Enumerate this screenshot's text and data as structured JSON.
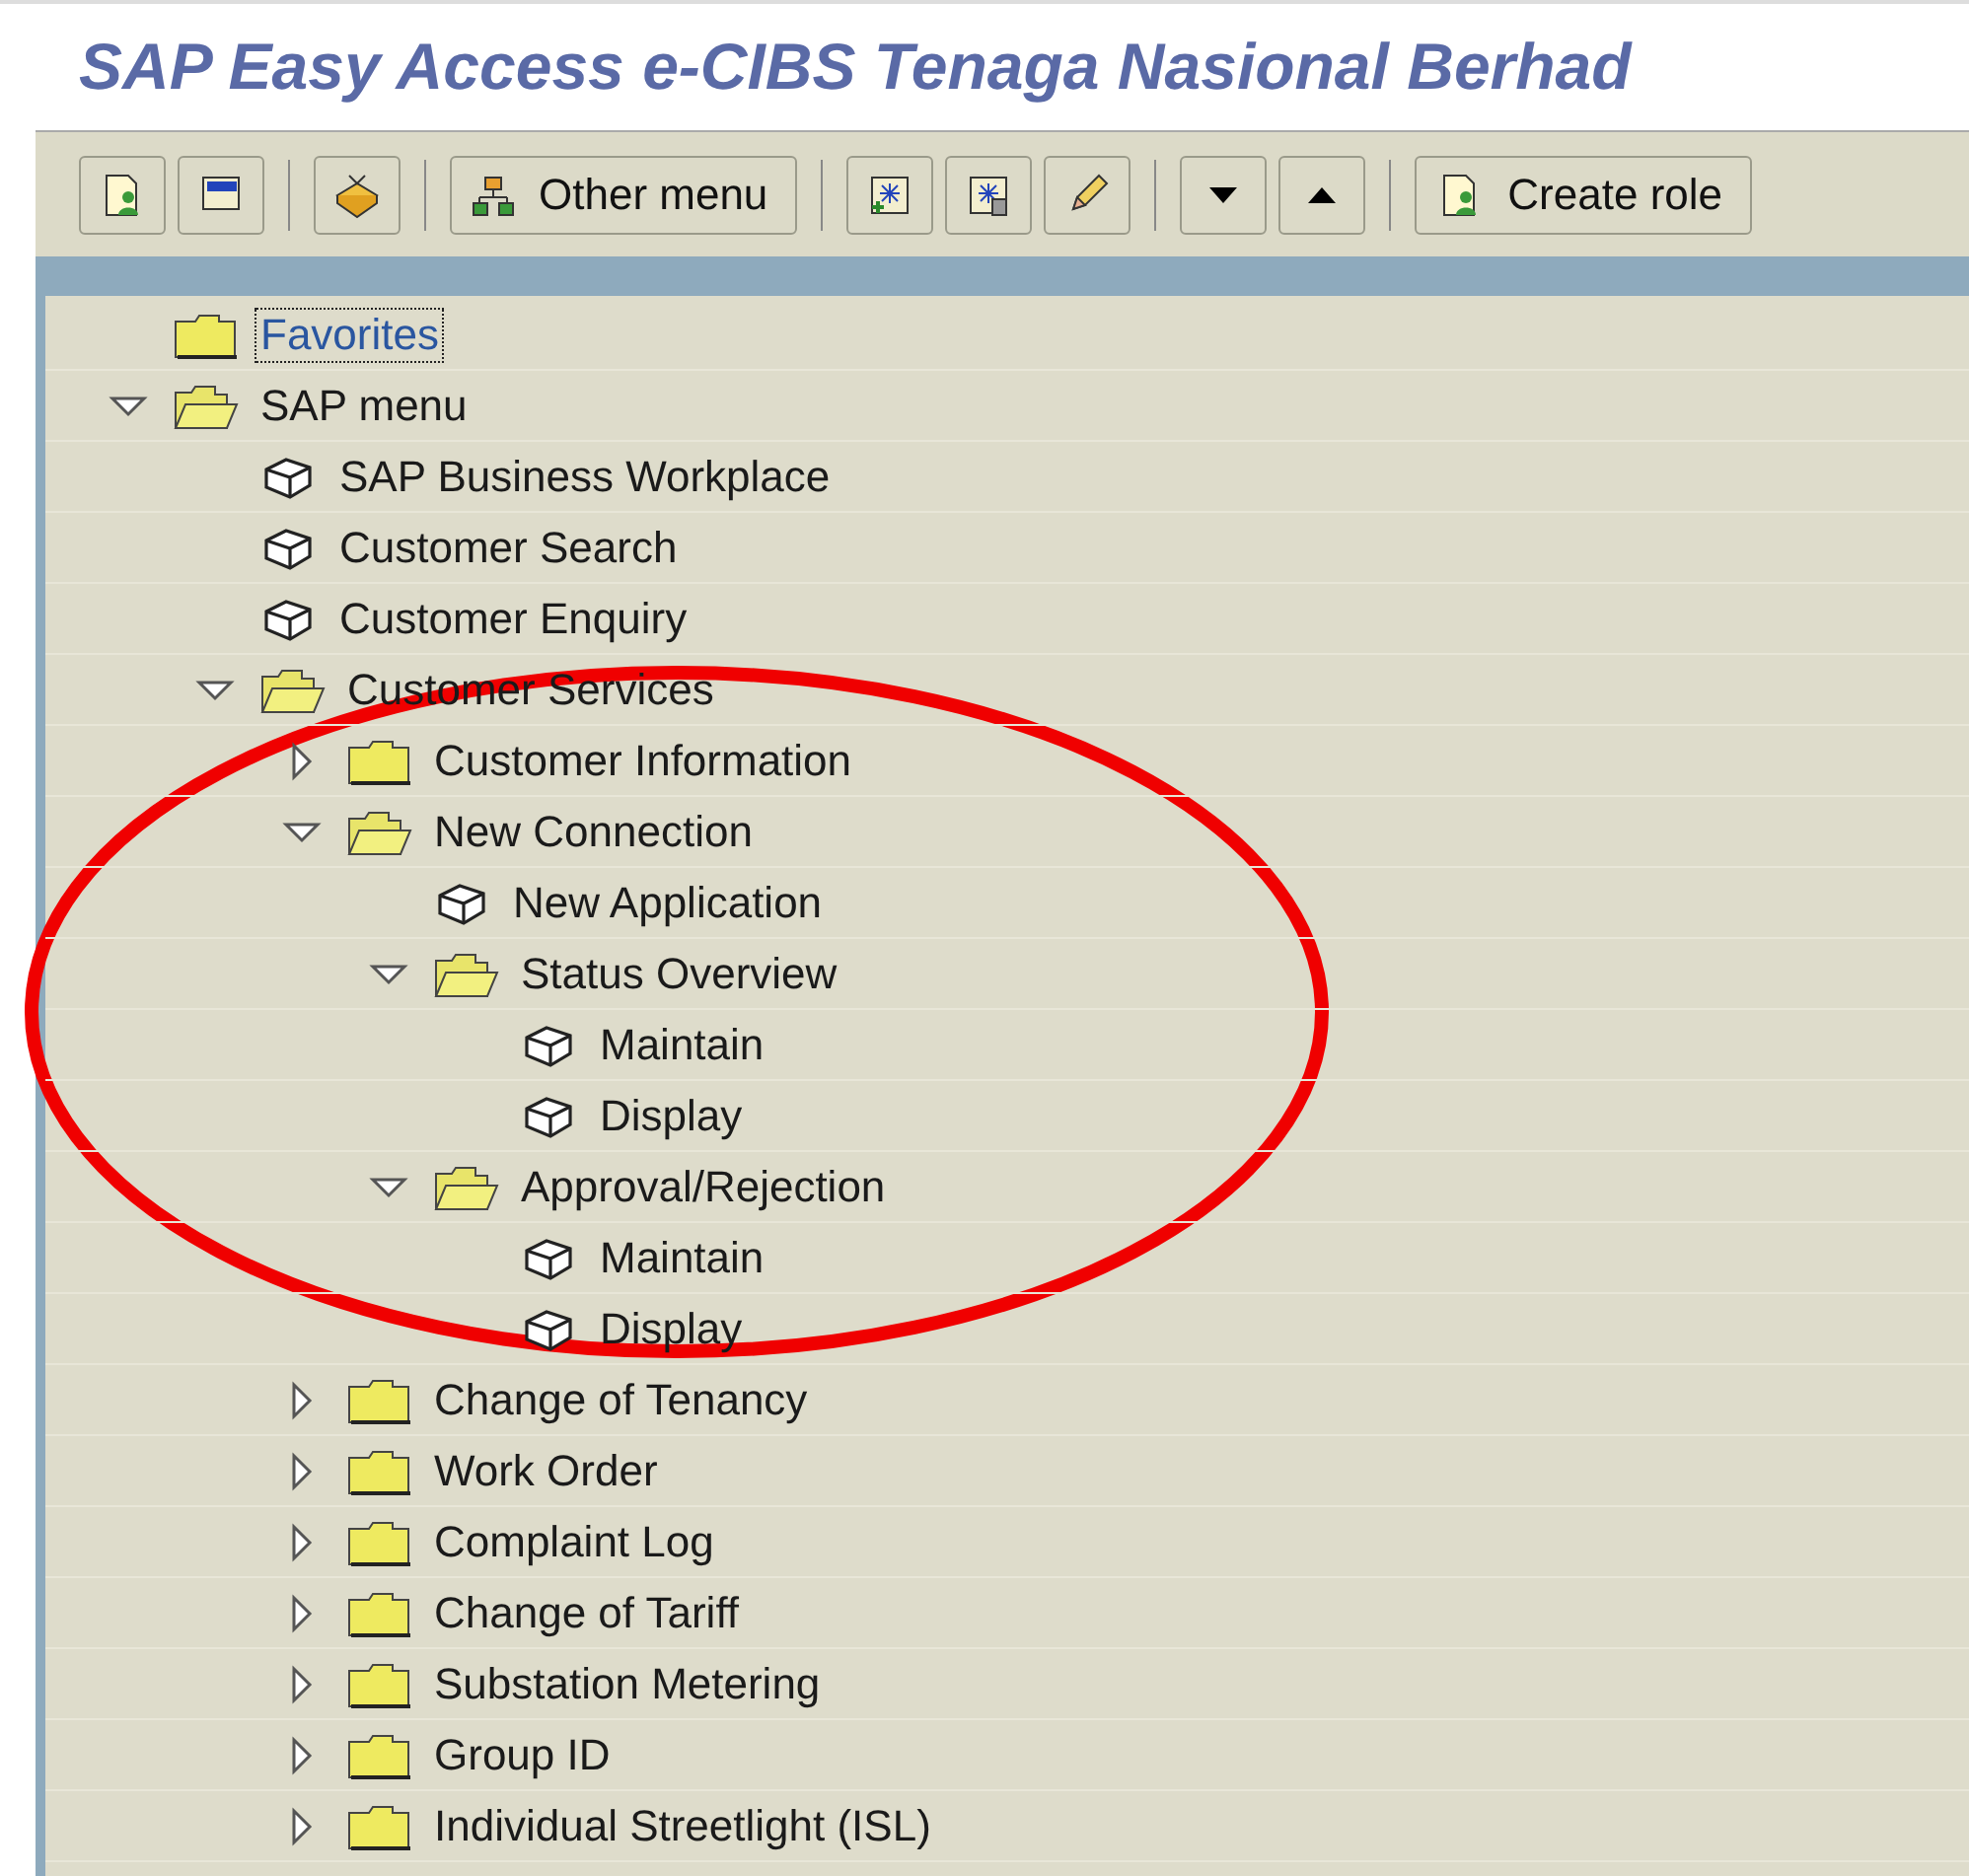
{
  "window": {
    "title": "SAP Easy Access  e-CIBS Tenaga Nasional Berhad"
  },
  "toolbar": {
    "buttons": [
      {
        "label": "Other menu"
      },
      {
        "label": "Create role"
      }
    ]
  },
  "tree": [
    {
      "kind": "favorites",
      "label": "Favorites",
      "selected": true
    },
    {
      "kind": "folder",
      "label": "SAP menu",
      "selected": false,
      "expanded": true,
      "children": [
        {
          "kind": "transaction",
          "label": "SAP Business Workplace",
          "selected": false
        },
        {
          "kind": "transaction",
          "label": "Customer Search",
          "selected": false
        },
        {
          "kind": "transaction",
          "label": "Customer Enquiry",
          "selected": false
        },
        {
          "kind": "folder",
          "label": "Customer Services",
          "selected": false,
          "expanded": true,
          "children": [
            {
              "kind": "folder",
              "label": "Customer Information",
              "selected": false,
              "expanded": false
            },
            {
              "kind": "folder",
              "label": "New Connection",
              "selected": false,
              "expanded": true,
              "children": [
                {
                  "kind": "transaction",
                  "label": "New Application",
                  "selected": false
                },
                {
                  "kind": "folder",
                  "label": "Status Overview",
                  "selected": false,
                  "expanded": true,
                  "children": [
                    {
                      "kind": "transaction",
                      "label": "Maintain",
                      "selected": false
                    },
                    {
                      "kind": "transaction",
                      "label": "Display",
                      "selected": false
                    }
                  ]
                },
                {
                  "kind": "folder",
                  "label": "Approval/Rejection",
                  "selected": false,
                  "expanded": true,
                  "children": [
                    {
                      "kind": "transaction",
                      "label": "Maintain",
                      "selected": false
                    },
                    {
                      "kind": "transaction",
                      "label": "Display",
                      "selected": false
                    }
                  ]
                }
              ]
            },
            {
              "kind": "folder",
              "label": "Change of Tenancy",
              "selected": false,
              "expanded": false
            },
            {
              "kind": "folder",
              "label": "Work Order",
              "selected": false,
              "expanded": false
            },
            {
              "kind": "folder",
              "label": "Complaint Log",
              "selected": false,
              "expanded": false
            },
            {
              "kind": "folder",
              "label": "Change of Tariff",
              "selected": false,
              "expanded": false
            },
            {
              "kind": "folder",
              "label": "Substation Metering",
              "selected": false,
              "expanded": false
            },
            {
              "kind": "folder",
              "label": "Group ID",
              "selected": false,
              "expanded": false
            },
            {
              "kind": "folder",
              "label": "Individual Streetlight (ISL)",
              "selected": false,
              "expanded": false
            }
          ]
        }
      ]
    }
  ]
}
